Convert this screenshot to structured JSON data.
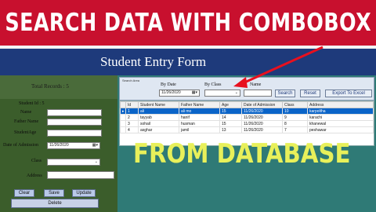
{
  "banner": {
    "title": "SEARCH DATA WITH COMBOBOX"
  },
  "header": {
    "title": "Student Entry Form"
  },
  "left": {
    "records_label": "Total Records : 5",
    "student_id_label": "Student Id : 5",
    "name_label": "Name",
    "father_label": "Father Name",
    "age_label": "StudentAge",
    "doa_label": "Date of Admission",
    "doa_value": "11/26/2020",
    "class_label": "Class",
    "address_label": "Address",
    "clear": "Clear",
    "save": "Save",
    "update": "Update",
    "delete": "Delete"
  },
  "search": {
    "title": "Search Area",
    "by_date_label": "By Date",
    "by_date_value": "11/26/2020",
    "by_class_label": "By Class",
    "name_label": "Name",
    "search_btn": "Search",
    "reset_btn": "Reset",
    "export_btn": "Export To Excel"
  },
  "grid": {
    "columns": [
      "",
      "Id",
      "Student Name",
      "Father Name",
      "Age",
      "Date of Admission",
      "Class",
      "Address"
    ],
    "rows": [
      [
        "▸",
        "1",
        "ali",
        "ali mo",
        "15",
        "11/26/2020",
        "10",
        "karpoltha"
      ],
      [
        "",
        "2",
        "tayyab",
        "hanif",
        "14",
        "11/26/2020",
        "9",
        "karachi"
      ],
      [
        "",
        "3",
        "sohail",
        "husman",
        "15",
        "11/26/2020",
        "8",
        "khanewal"
      ],
      [
        "",
        "4",
        "asghar",
        "jamil",
        "13",
        "11/26/2020",
        "7",
        "peshawar"
      ]
    ]
  },
  "overlay": {
    "text": "FROM DATABASE"
  },
  "colors": {
    "banner": "#c8102e",
    "header": "#1e3a7b",
    "left_panel": "#3b5d2b",
    "right_panel": "#2f7a76",
    "overlay_text": "#e8f05a",
    "arrow": "#e8101e"
  }
}
